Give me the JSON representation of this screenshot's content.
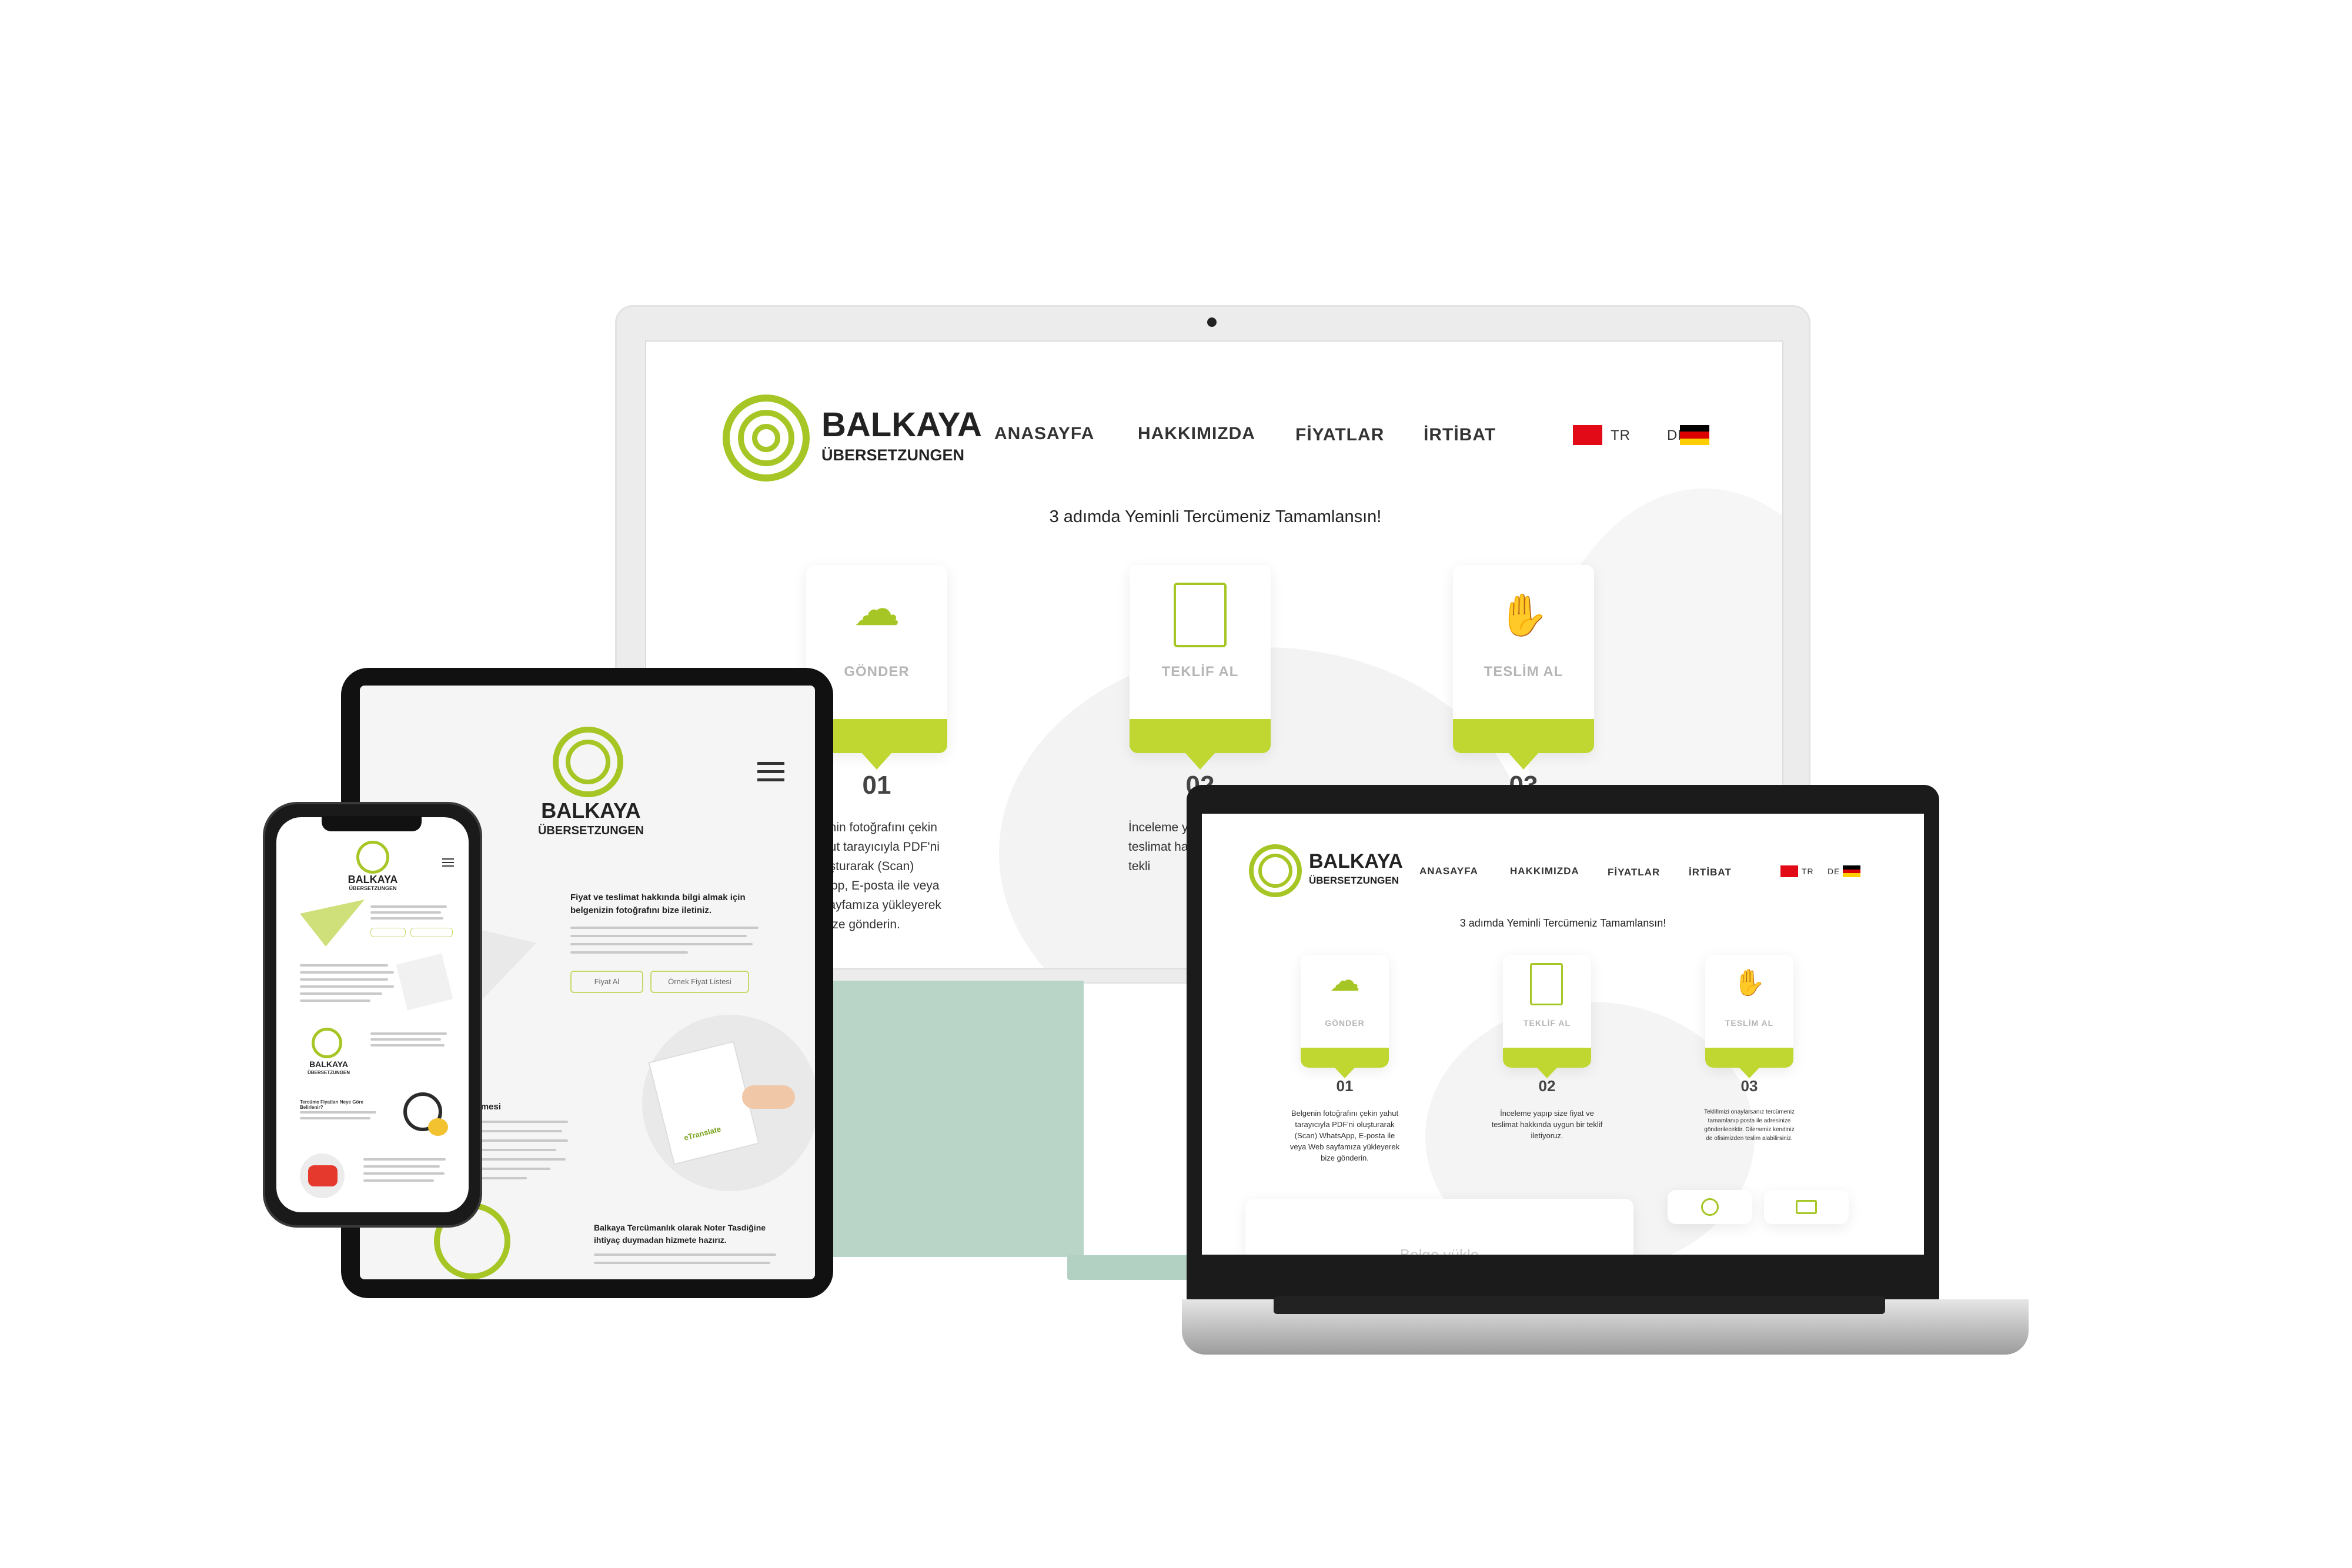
{
  "brand": {
    "name": "BALKAYA",
    "sub": "ÜBERSETZUNGEN"
  },
  "nav": {
    "items": [
      "ANASAYFA",
      "HAKKIMIZDA",
      "FİYATLAR",
      "İRTİBAT"
    ],
    "lang_tr": "TR",
    "lang_de": "DE"
  },
  "hero": {
    "title": "3 adımda Yeminli Tercümeniz Tamamlansın!"
  },
  "steps": [
    {
      "label": "GÖNDER",
      "num": "01",
      "icon": "cloud-upload-icon",
      "text": "Belgenin fotoğrafını çekin yahut tarayıcıyla PDF'ni oluşturarak (Scan) WhatsApp, E-posta ile veya Web sayfamıza yükleyerek bize gönderin."
    },
    {
      "label": "TEKLİF AL",
      "num": "02",
      "icon": "document-price-icon",
      "text": "İnceleme yapıp size fiyat ve teslimat hakkında uygun bir teklif iletiyoruz."
    },
    {
      "label": "TESLİM AL",
      "num": "03",
      "icon": "handshake-icon",
      "text": "Teklifimizi onaylarsanız tercümeniz tamamlanıp posta ile adresinize gönderilecektir. Dilerseniz kendiniz de ofisimizden teslim alabilirsiniz."
    }
  ],
  "monitor_partial": {
    "text1": "enin fotoğrafını çekin",
    "text2": "hut tarayıcıyla PDF'ni",
    "text3": "uşturarak (Scan)",
    "text4": "App, E-posta ile veya",
    "text5": "sayfamıza yükleyerek",
    "text6": "bize gönderin.",
    "step2a": "İnceleme ya",
    "step2b": "teslimat ha",
    "step2c": "tekli"
  },
  "laptop": {
    "upload_label": "Belge yükle"
  },
  "tablet": {
    "intro_title": "Fiyat ve teslimat hakkında bilgi almak için belgenizin fotoğrafını bize iletiniz.",
    "btn_price": "Fiyat Al",
    "btn_list": "Örnek Fiyat Listesi",
    "section_title": "mında dikkat edilmesi",
    "bottom_title": "Balkaya Tercümanlık olarak Noter Tasdiğine ihtiyaç duymadan hizmete hazırız.",
    "watermark": "eTranslate"
  },
  "phone": {
    "q1": "Tercüme Fiyatları Neye Göre Belirlenir?"
  },
  "colors": {
    "accent": "#bfd730",
    "logo": "#a6c625",
    "stand": "#b8d5c8"
  }
}
